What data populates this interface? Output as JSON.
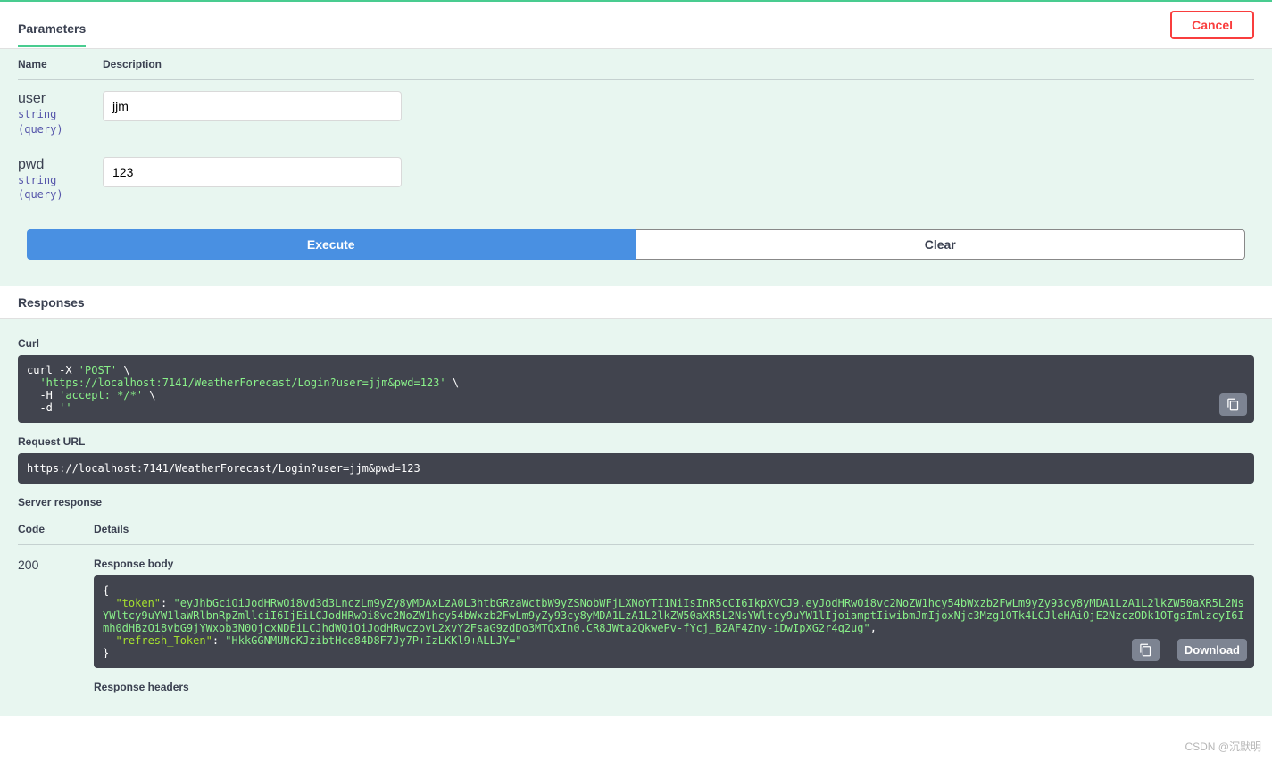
{
  "tabs": {
    "parameters": "Parameters"
  },
  "cancel": "Cancel",
  "columns": {
    "name": "Name",
    "description": "Description"
  },
  "params": [
    {
      "name": "user",
      "type": "string",
      "in": "(query)",
      "value": "jjm"
    },
    {
      "name": "pwd",
      "type": "string",
      "in": "(query)",
      "value": "123"
    }
  ],
  "buttons": {
    "execute": "Execute",
    "clear": "Clear",
    "download": "Download"
  },
  "responses_header": "Responses",
  "labels": {
    "curl": "Curl",
    "request_url": "Request URL",
    "server_response": "Server response",
    "code": "Code",
    "details": "Details",
    "response_body": "Response body",
    "response_headers": "Response headers"
  },
  "curl": {
    "line1a": "curl -X ",
    "line1b": "'POST'",
    "line1c": " \\",
    "line2a": "  ",
    "line2b": "'https://localhost:7141/WeatherForecast/Login?user=jjm&pwd=123'",
    "line2c": " \\",
    "line3a": "  -H ",
    "line3b": "'accept: */*'",
    "line3c": " \\",
    "line4a": "  -d ",
    "line4b": "''"
  },
  "request_url": "https://localhost:7141/WeatherForecast/Login?user=jjm&pwd=123",
  "response": {
    "code": "200",
    "body": {
      "open": "{",
      "token_key": "  \"token\"",
      "token_colon": ": ",
      "token_val": "\"eyJhbGciOiJodHRwOi8vd3d3LnczLm9yZy8yMDAxLzA0L3htbGRzaWctbW9yZSNobWFjLXNoYTI1NiIsInR5cCI6IkpXVCJ9.eyJodHRwOi8vc2NoZW1hcy54bWxzb2FwLm9yZy93cy8yMDA1LzA1L2lkZW50aXR5L2NsYWltcy9uYW1laWRlbnRpZmllciI6IjEiLCJodHRwOi8vc2NoZW1hcy54bWxzb2FwLm9yZy93cy8yMDA1LzA1L2lkZW50aXR5L2NsYWltcy9uYW1lIjoiamptIiwibmJmIjoxNjc3Mzg1OTk4LCJleHAiOjE2NzczODk1OTgsImlzcyI6Imh0dHBzOi8vbG9jYWxob3N0OjcxNDEiLCJhdWQiOiJodHRwczovL2xvY2FsaG9zdDo3MTQxIn0.CR8JWta2QkwePv-fYcj_B2AF4Zny-iDwIpXG2r4q2ug\"",
      "comma": ",",
      "refresh_key": "  \"refresh_Token\"",
      "refresh_colon": ": ",
      "refresh_val": "\"HkkGGNMUNcKJzibtHce84D8F7Jy7P+IzLKKl9+ALLJY=\"",
      "close": "}"
    }
  },
  "watermark": "CSDN @沉默明"
}
